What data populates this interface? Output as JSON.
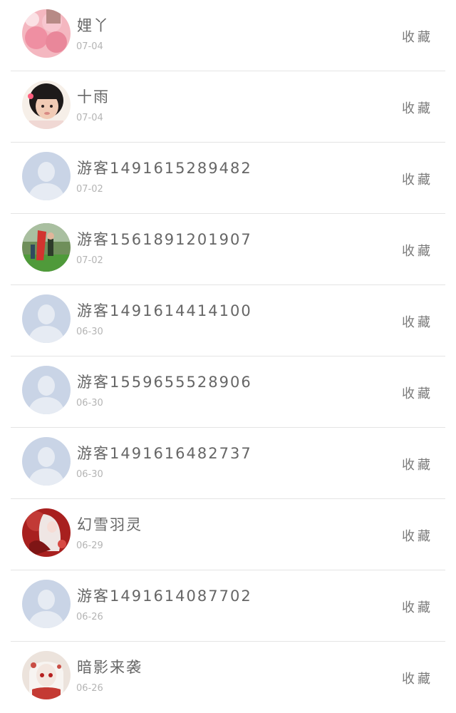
{
  "accent": "#c9d4e6",
  "fav_label": "收藏",
  "items": [
    {
      "name": "娌丫",
      "date": "07-04",
      "avatar": "balloon-photo-avatar"
    },
    {
      "name": "十雨",
      "date": "07-04",
      "avatar": "girl-photo-avatar"
    },
    {
      "name": "游客1491615289482",
      "date": "07-02",
      "avatar": "default-avatar"
    },
    {
      "name": "游客1561891201907",
      "date": "07-02",
      "avatar": "outdoor-photo-avatar"
    },
    {
      "name": "游客1491614414100",
      "date": "06-30",
      "avatar": "default-avatar"
    },
    {
      "name": "游客1559655528906",
      "date": "06-30",
      "avatar": "default-avatar"
    },
    {
      "name": "游客1491616482737",
      "date": "06-30",
      "avatar": "default-avatar"
    },
    {
      "name": "幻雪羽灵",
      "date": "06-29",
      "avatar": "anime-red-avatar"
    },
    {
      "name": "游客1491614087702",
      "date": "06-26",
      "avatar": "default-avatar"
    },
    {
      "name": "暗影来袭",
      "date": "06-26",
      "avatar": "anime-white-avatar"
    }
  ]
}
